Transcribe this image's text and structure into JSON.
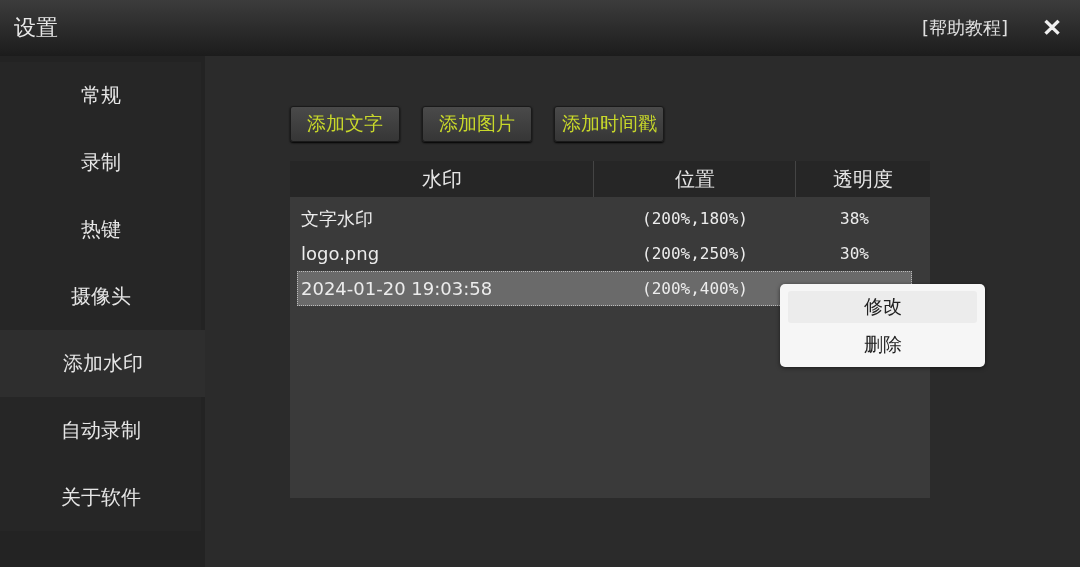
{
  "window": {
    "title": "设置",
    "help_link": "[帮助教程]",
    "close": "✕"
  },
  "sidebar": {
    "items": [
      {
        "label": "常规",
        "selected": false
      },
      {
        "label": "录制",
        "selected": false
      },
      {
        "label": "热键",
        "selected": false
      },
      {
        "label": "摄像头",
        "selected": false
      },
      {
        "label": "添加水印",
        "selected": true
      },
      {
        "label": "自动录制",
        "selected": false
      },
      {
        "label": "关于软件",
        "selected": false
      }
    ]
  },
  "buttons": [
    "添加文字",
    "添加图片",
    "添加时间戳"
  ],
  "table": {
    "columns": [
      "水印",
      "位置",
      "透明度"
    ],
    "rows": [
      {
        "cells": [
          "文字水印",
          "(200%,180%)",
          "38%"
        ],
        "selected": false
      },
      {
        "cells": [
          "logo.png",
          "(200%,250%)",
          "30%"
        ],
        "selected": false
      },
      {
        "cells": [
          "2024-01-20 19:03:58",
          "(200%,400%)"
        ],
        "selected": true
      }
    ]
  },
  "context_menu": {
    "items": [
      "修改",
      "删除"
    ]
  }
}
